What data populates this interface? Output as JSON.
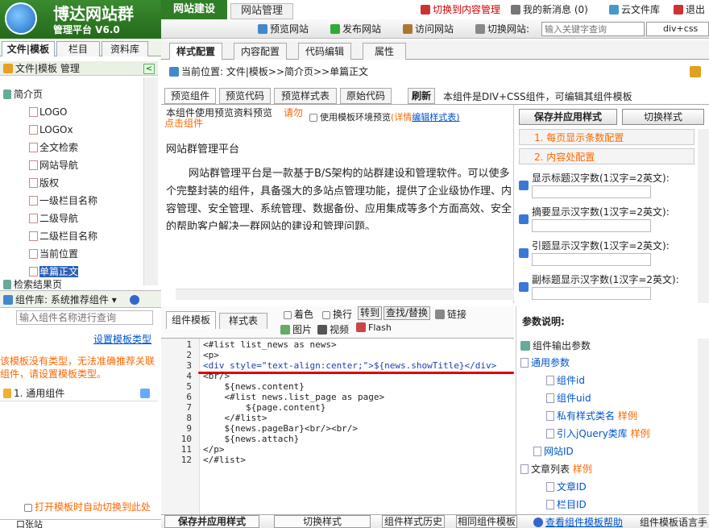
{
  "header": {
    "brand_title": "博达网站群",
    "brand_sub": "管理平台  V6.0",
    "tab_site": "网站建设",
    "tab_content": "网站管理",
    "link_switch_content": "切换到内容管理",
    "link_messages": "我的新消息 (0)",
    "link_cloud": "云文件库",
    "link_logout": "退出",
    "preview_site": "预览网站",
    "publish_site": "发布网站",
    "visit_site": "访问网站",
    "switch_site": "切换网站:",
    "search_placeholder": "输入关键字查询",
    "select_value": "div+css"
  },
  "left": {
    "tab_file": "文件|模板",
    "tab_column": "栏目",
    "tab_res": "资料库",
    "header": "文件|模板 管理",
    "tree_parent": "简介页",
    "tree_items": [
      "LOGO",
      "LOGOx",
      "全文检索",
      "网站导航",
      "版权",
      "一级栏目名称",
      "二级导航",
      "二级栏目名称",
      "当前位置",
      "单篇正文"
    ],
    "tree_next": "检索结果页",
    "lib_label": "组件库:",
    "lib_value": "系统推荐组件",
    "lib_placeholder": "输入组件名称进行查询",
    "set_type_link": "设置模板类型",
    "warn": "该模板没有类型，无法准确推荐关联组件，请设置模板类型。",
    "group_item": "1. 通用组件",
    "auto_switch": "打开模板时自动切换到此处",
    "bottom_item": "口张站"
  },
  "main": {
    "tabs": [
      "样式配置",
      "内容配置",
      "代码编辑",
      "属性"
    ],
    "breadcrumb": "当前位置: 文件|模板>>简介页>>单篇正文",
    "preview_tabs": [
      "预览组件",
      "预览代码",
      "预览样式表",
      "原始代码"
    ],
    "refresh": "刷新",
    "component_note": "本组件是DIV+CSS组件，可编辑其组件模板",
    "preview_note": "本组件使用预览资料预览",
    "preview_note_orange": "请勿点击组件",
    "env_preview": "使用模板环境预览",
    "detail": "(详情",
    "edit_style": "编辑样式表)",
    "preview_title": "网站群管理平台",
    "preview_body": "网站群管理平台是一款基于B/S架构的站群建设和管理软件。可以使多个完整封装的组件，具备强大的多站点管理功能，提供了企业级协作理、内容管理、安全管理、系统管理、数据备份、应用集成等多个方面高效、安全的帮助客户解决一群网站的建设和管理问题。",
    "save_apply": "保存并应用样式",
    "switch_style": "切换样式",
    "cfg_sections": [
      "1. 每页显示条数配置",
      "2. 内容处配置"
    ],
    "cfg_fields": [
      "显示标题汉字数(1汉字=2英文):",
      "摘要显示汉字数(1汉字=2英文):",
      "引题显示汉字数(1汉字=2英文):",
      "副标题显示汉字数(1汉字=2英文):"
    ]
  },
  "editor": {
    "tab_template": "组件模板",
    "tab_style": "样式表",
    "tool_color": "着色",
    "tool_wrap": "换行",
    "tool_goto": "转到",
    "tool_find": "查找/替换",
    "tool_link": "链接",
    "tool_image": "图片",
    "tool_video": "视频",
    "tool_flash": "Flash",
    "lines": [
      "<#list list_news as news>",
      "<p>",
      "<div style=\"text-align:center;\">${news.showTitle}</div>",
      "<br/>",
      "    ${news.content}",
      "    <#list news.list_page as page>",
      "        ${page.content}",
      "    </#list>",
      "    ${news.pageBar}<br/><br/>",
      "    ${news.attach}",
      "</p>",
      "</#list>"
    ],
    "line_numbers": [
      "1",
      "2",
      "3",
      "4",
      "5",
      "6",
      "7",
      "8",
      "9",
      "10",
      "11",
      "12"
    ]
  },
  "params": {
    "title": "参数说明:",
    "root": "组件输出参数",
    "common": "通用参数",
    "items": [
      "组件id",
      "组件uid",
      "私有样式类名",
      "引入jQuery类库"
    ],
    "style_tag": "样例",
    "site_id": "网站ID",
    "article_list": "文章列表",
    "article_items": [
      "文章ID",
      "栏目ID"
    ]
  },
  "bottom": {
    "save_apply": "保存并应用样式",
    "switch_style": "切换样式",
    "history": "组件样式历史",
    "same_template": "相同组件模板",
    "help": "查看组件模板帮助",
    "lang": "组件模板语言手"
  },
  "colors": {
    "brand_green": "#2f7d26",
    "accent_orange": "#ff6600",
    "link_blue": "#0055cc",
    "red_underline": "#e00000"
  }
}
